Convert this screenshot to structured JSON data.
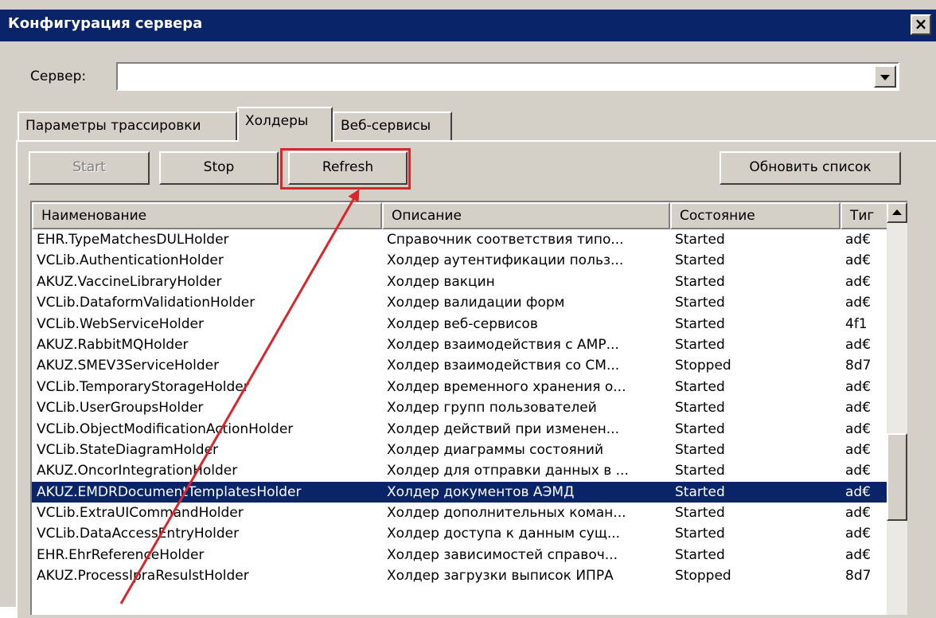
{
  "window": {
    "title": "Конфигурация сервера"
  },
  "server": {
    "label": "Сервер:",
    "value": ""
  },
  "tabs": [
    {
      "label": "Параметры трассировки",
      "active": false
    },
    {
      "label": "Холдеры",
      "active": true
    },
    {
      "label": "Веб-сервисы",
      "active": false
    }
  ],
  "toolbar": {
    "start_label": "Start",
    "stop_label": "Stop",
    "refresh_label": "Refresh",
    "update_list_label": "Обновить список"
  },
  "table": {
    "columns": [
      "Наименование",
      "Описание",
      "Состояние",
      "Тиг"
    ],
    "selected_index": 12,
    "rows": [
      [
        "EHR.TypeMatchesDULHolder",
        "Справочник соответствия типо...",
        "Started",
        "ad€"
      ],
      [
        "VCLib.AuthenticationHolder",
        "Холдер аутентификации польз...",
        "Started",
        "ad€"
      ],
      [
        "AKUZ.VaccineLibraryHolder",
        "Холдер вакцин",
        "Started",
        "ad€"
      ],
      [
        "VCLib.DataformValidationHolder",
        "Холдер валидации форм",
        "Started",
        "ad€"
      ],
      [
        "VCLib.WebServiceHolder",
        "Холдер веб-сервисов",
        "Started",
        "4f1"
      ],
      [
        "AKUZ.RabbitMQHolder",
        "Холдер взаимодействия с АМР...",
        "Started",
        "ad€"
      ],
      [
        "AKUZ.SMEV3ServiceHolder",
        "Холдер взаимодействия со СМ...",
        "Stopped",
        "8d7"
      ],
      [
        "VCLib.TemporaryStorageHolder",
        "Холдер временного хранения о...",
        "Started",
        "ad€"
      ],
      [
        "VCLib.UserGroupsHolder",
        "Холдер групп пользователей",
        "Started",
        "ad€"
      ],
      [
        "VCLib.ObjectModificationActionHolder",
        "Холдер действий при изменен...",
        "Started",
        "ad€"
      ],
      [
        "VCLib.StateDiagramHolder",
        "Холдер диаграммы состояний",
        "Started",
        "ad€"
      ],
      [
        "AKUZ.OncorIntegrationHolder",
        "Холдер для отправки данных в ...",
        "Started",
        "ad€"
      ],
      [
        "AKUZ.EMDRDocumentTemplatesHolder",
        "Холдер документов АЭМД",
        "Started",
        "ad€"
      ],
      [
        "VCLib.ExtraUICommandHolder",
        "Холдер дополнительных коман...",
        "Started",
        "ad€"
      ],
      [
        "VCLib.DataAccessEntryHolder",
        "Холдер доступа к данным сущ...",
        "Started",
        "ad€"
      ],
      [
        "EHR.EhrReferenceHolder",
        "Холдер зависимостей справоч...",
        "Started",
        "ad€"
      ],
      [
        "AKUZ.ProcessIpraResulstHolder",
        "Холдер загрузки выписок ИПРА",
        "Stopped",
        "8d7"
      ]
    ]
  },
  "annotation": {
    "color": "#d9262a"
  }
}
